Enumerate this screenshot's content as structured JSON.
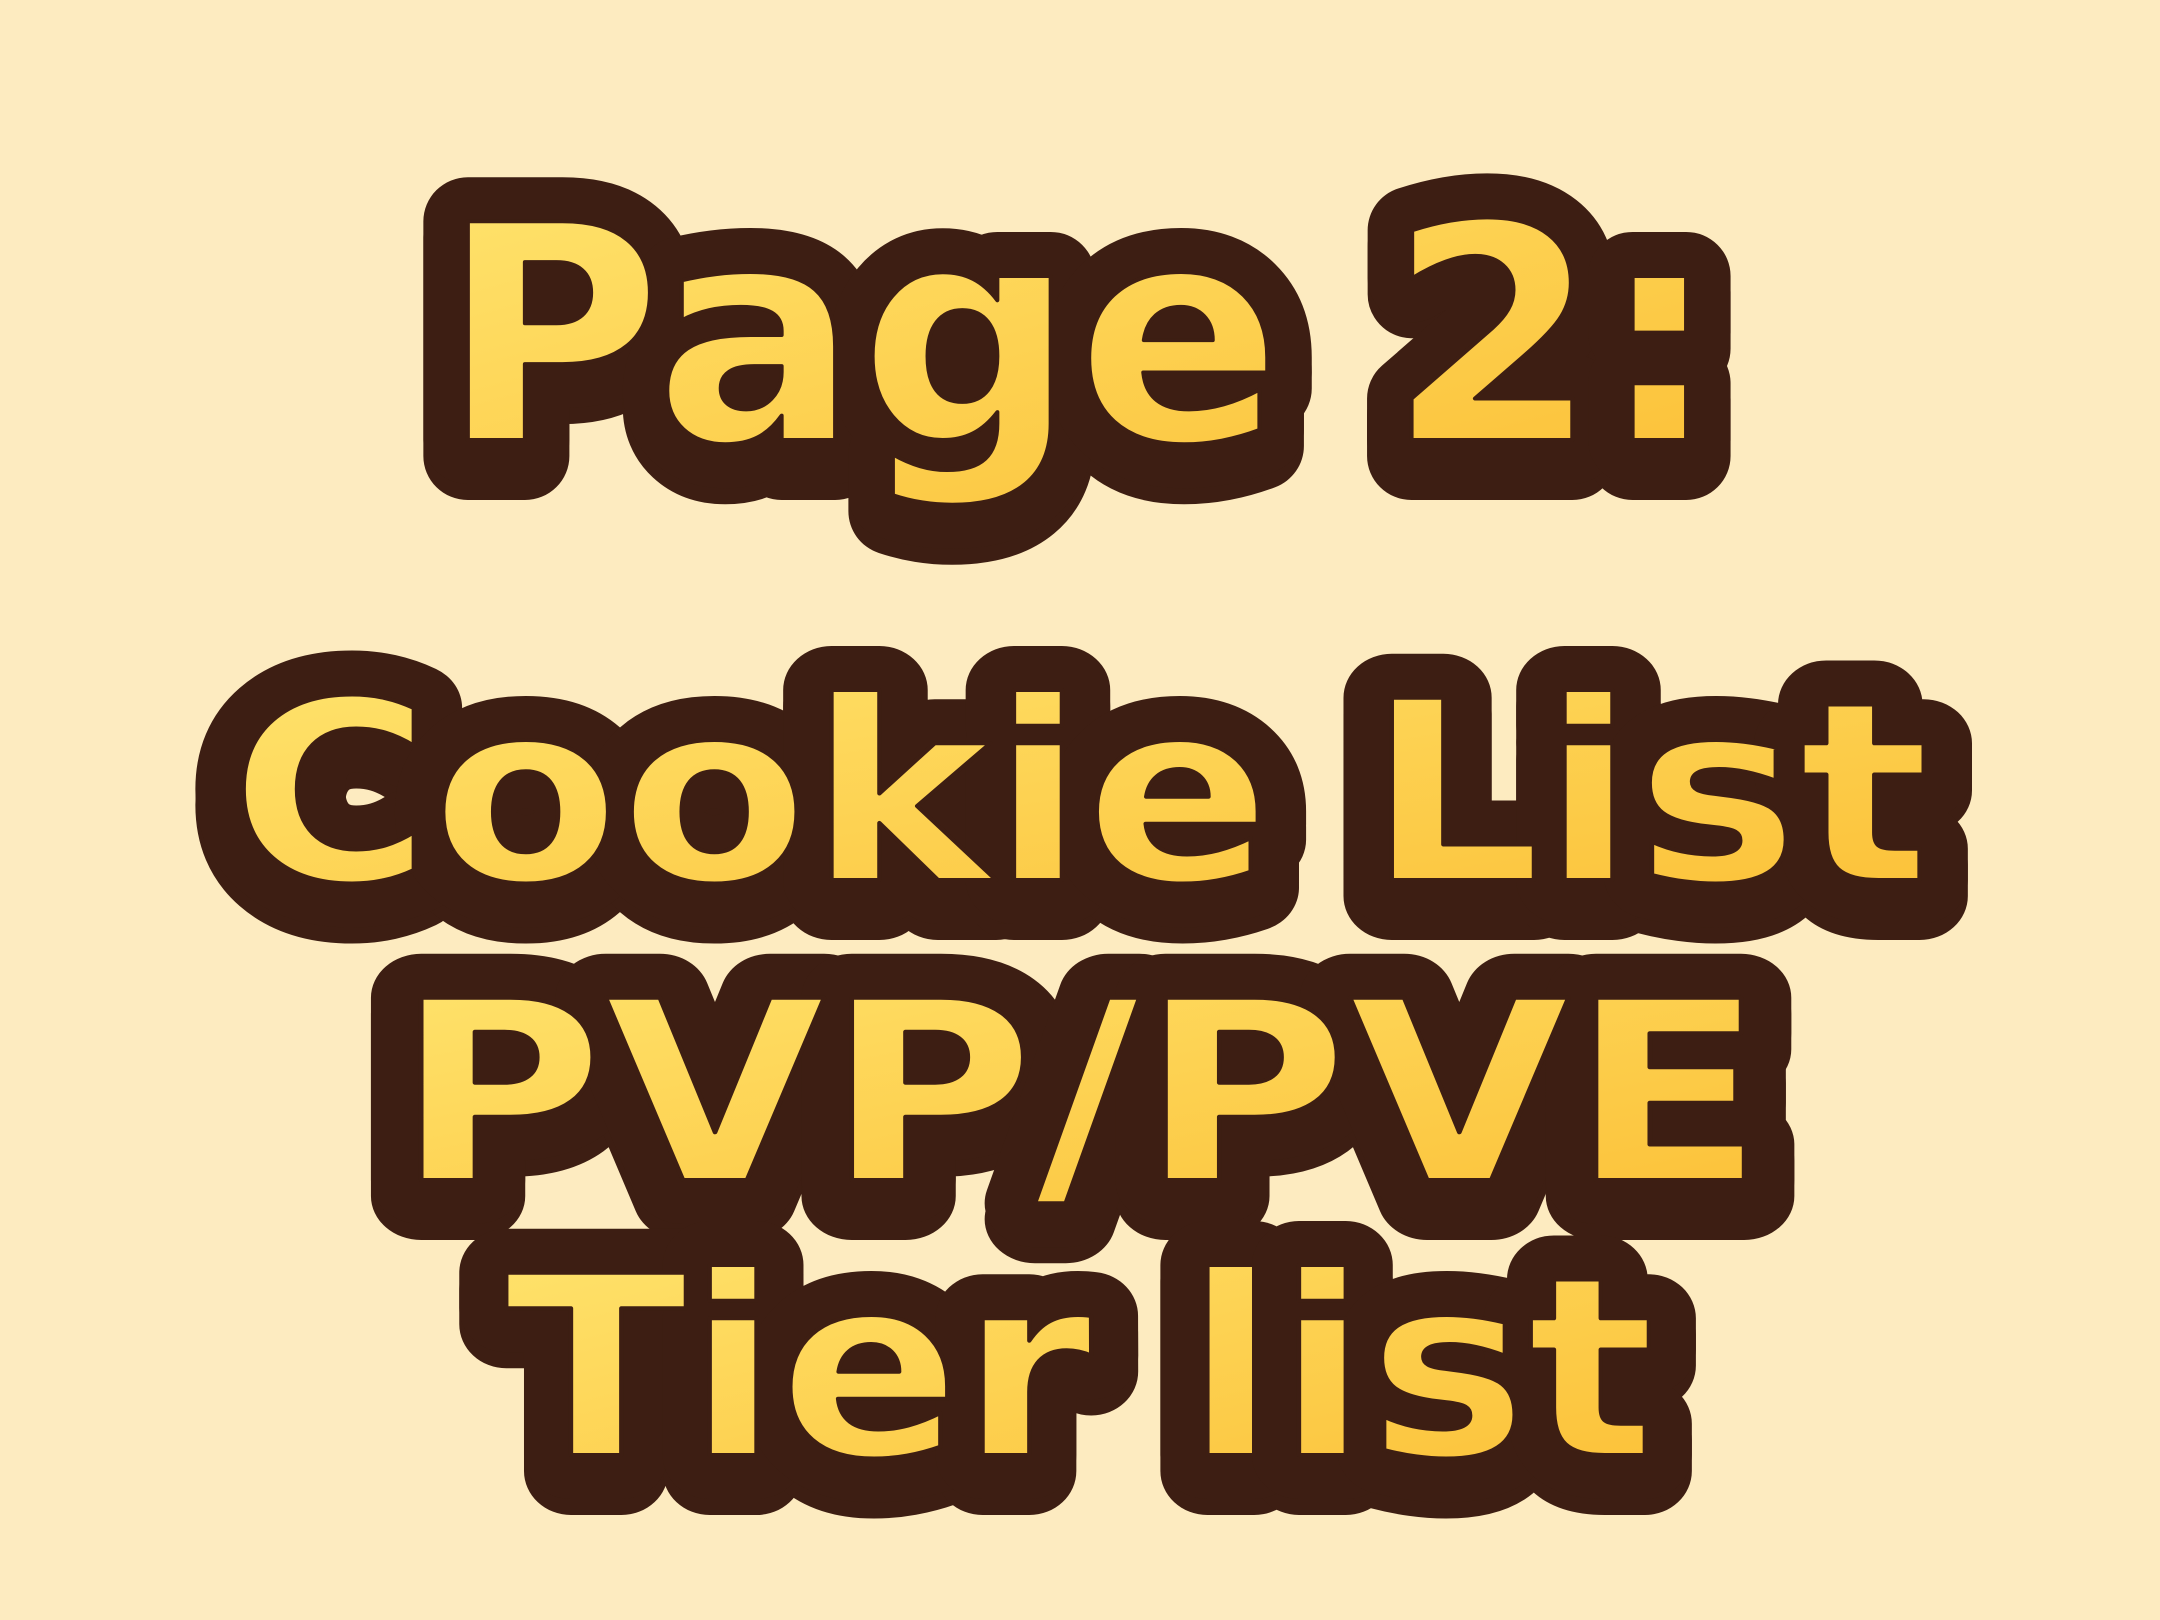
{
  "background_color": "#fdebc0",
  "outline_color": "#3d1e13",
  "text_gradient": [
    "#ffe46e",
    "#fbbf35"
  ],
  "title_lines": [
    "Page 2:",
    "Cookie List",
    "PVP/PVE",
    "Tier list"
  ]
}
